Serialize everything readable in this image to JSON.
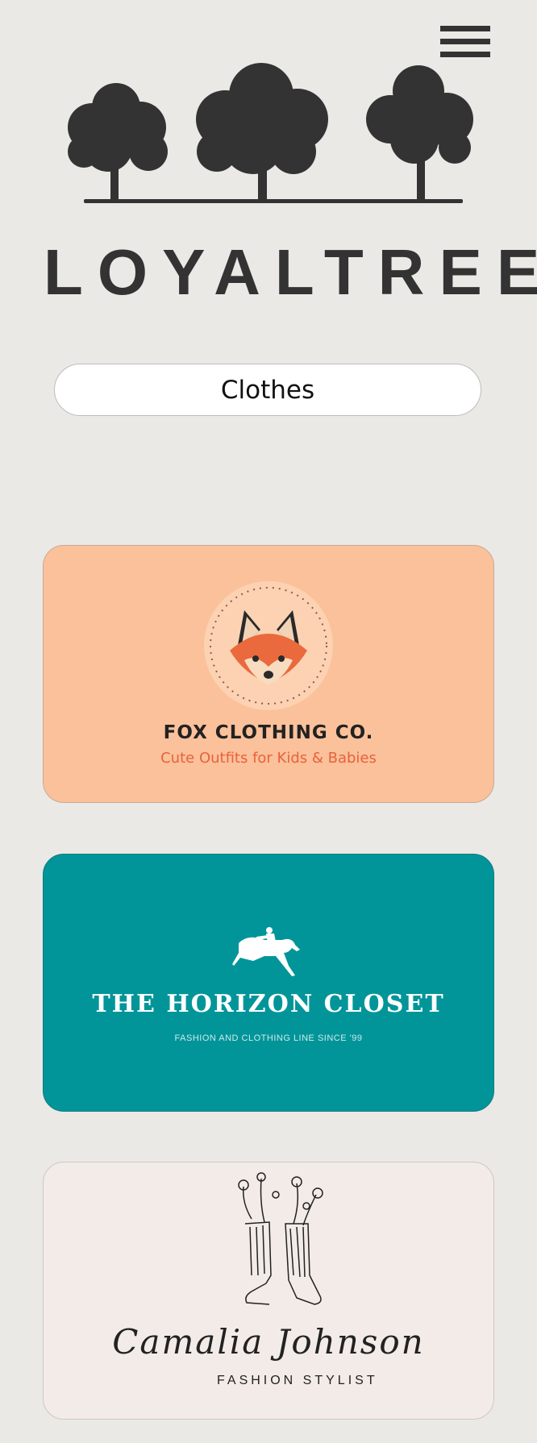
{
  "brand": {
    "name": "LOYALTREE"
  },
  "category": {
    "label": "Clothes"
  },
  "cards": [
    {
      "title": "FOX CLOTHING CO.",
      "subtitle": "Cute Outfits for Kids & Babies",
      "background": "#fbc19a",
      "accent": "#e8623c",
      "icon": "fox-icon"
    },
    {
      "title": "THE HORIZON CLOSET",
      "subtitle": "FASHION AND CLOTHING LINE SINCE '99",
      "background": "#019599",
      "icon": "horse-rider-icon"
    },
    {
      "title": "Camalia Johnson",
      "subtitle": "FASHION STYLIST",
      "background": "#f2ebe7",
      "icon": "flower-boots-icon"
    }
  ],
  "icons": {
    "menu": "hamburger-menu-icon",
    "logo": "trees-logo-icon"
  }
}
